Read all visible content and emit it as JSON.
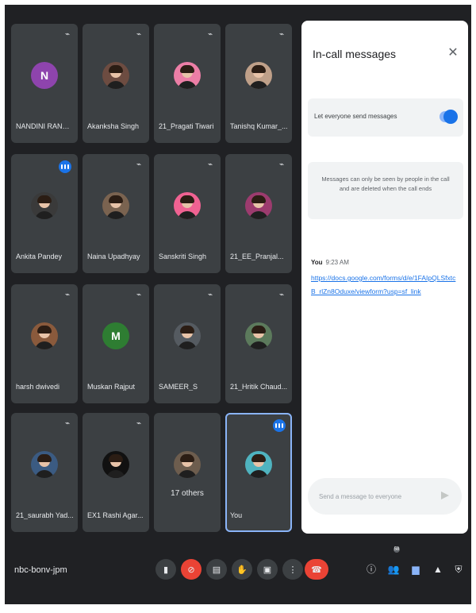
{
  "tiles": [
    {
      "name": "NANDINI RANDI...",
      "initial": "N",
      "color": "#8e44ad",
      "status": "mic-off"
    },
    {
      "name": "Akanksha Singh",
      "initial": "",
      "color": "#6d4c41",
      "status": "mic-off"
    },
    {
      "name": "21_Pragati Tiwari",
      "initial": "",
      "color": "#ec7ea6",
      "status": "mic-off"
    },
    {
      "name": "Tanishq Kumar_...",
      "initial": "",
      "color": "#bfa089",
      "status": "mic-off"
    },
    {
      "name": "Ankita Pandey",
      "initial": "",
      "color": "#3a3a3a",
      "status": "speaking"
    },
    {
      "name": "Naina Upadhyay",
      "initial": "",
      "color": "#7a6350",
      "status": "mic-off"
    },
    {
      "name": "Sanskriti Singh",
      "initial": "",
      "color": "#f06292",
      "status": "mic-off"
    },
    {
      "name": "21_EE_Pranjal...",
      "initial": "",
      "color": "#9c3b6e",
      "status": "mic-off"
    },
    {
      "name": "harsh dwivedi",
      "initial": "",
      "color": "#8a5a3c",
      "status": "mic-off"
    },
    {
      "name": "Muskan Rajput",
      "initial": "M",
      "color": "#2e7d32",
      "status": "mic-off"
    },
    {
      "name": "SAMEER_S",
      "initial": "",
      "color": "#555b61",
      "status": "mic-off"
    },
    {
      "name": "21_Hritik Chaud...",
      "initial": "",
      "color": "#5c7a5c",
      "status": "mic-off"
    },
    {
      "name": "21_saurabh Yad...",
      "initial": "",
      "color": "#3b5b82",
      "status": "mic-off"
    },
    {
      "name": "EX1 Rashi Agar...",
      "initial": "",
      "color": "#111111",
      "status": "mic-off"
    },
    {
      "name": "",
      "initial": "",
      "color": "#6d5d4e",
      "status": "none",
      "others": "17 others"
    },
    {
      "name": "You",
      "initial": "",
      "color": "#4fb3bf",
      "status": "speaking",
      "self": true
    }
  ],
  "panel": {
    "title": "In-call messages",
    "toggle_label": "Let everyone send messages",
    "info": "Messages can only be seen by people in the call and are deleted when the call ends",
    "message_sender": "You",
    "message_time": "9:23 AM",
    "message_link": "https://docs.google.com/forms/d/e/1FAIpQLSfxtcB_rlZn8Oduxe/viewform?usp=sf_link",
    "composer_placeholder": "Send a message to everyone"
  },
  "bottom": {
    "meeting_code": "nbc-bonv-jpm",
    "participant_count": "58"
  },
  "colors": {
    "background": "#202124",
    "tile": "#3c4043",
    "accent": "#1a73e8",
    "end_call": "#ea4335"
  }
}
